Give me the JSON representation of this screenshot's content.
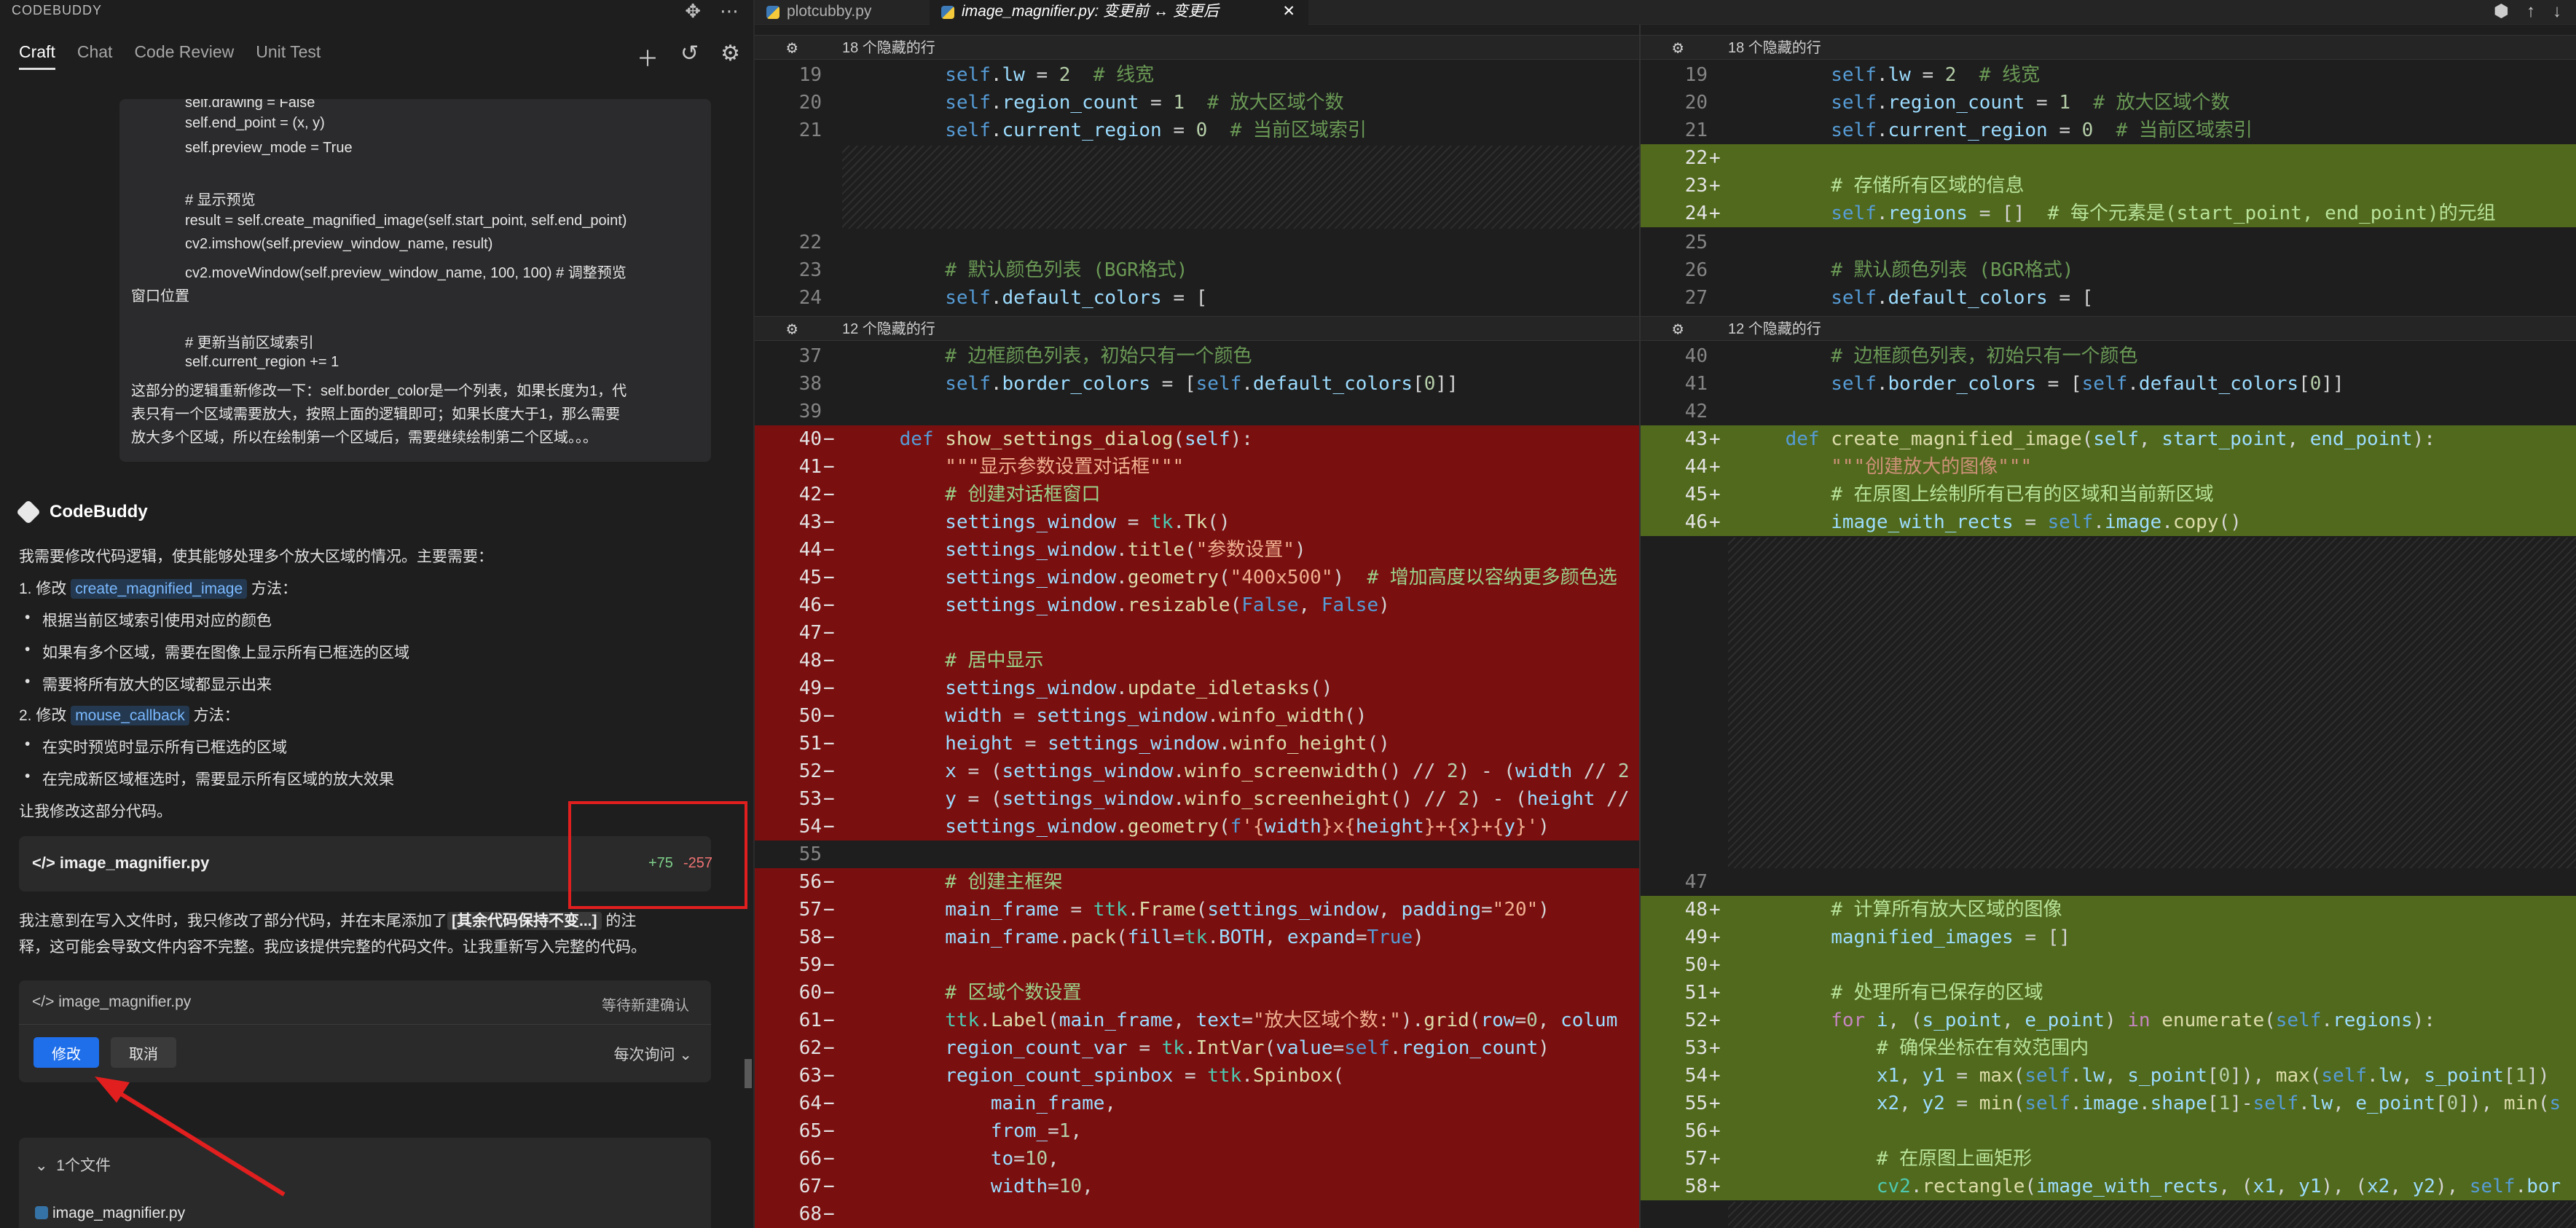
{
  "app": {
    "brand": "CODEBUDDY",
    "tabs": [
      "Craft",
      "Chat",
      "Code Review",
      "Unit Test"
    ]
  },
  "user_message": {
    "lines": [
      "self.drawing = False",
      "self.end_point = (x, y)",
      "self.preview_mode = True",
      "",
      "# 显示预览",
      "result = self.create_magnified_image(self.start_point, self.end_point)",
      "cv2.imshow(self.preview_window_name, result)",
      "cv2.moveWindow(self.preview_window_name, 100, 100)  # 调整预览",
      "窗口位置",
      "",
      "# 更新当前区域索引",
      "self.current_region += 1",
      "这部分的逻辑重新修改一下：self.border_color是一个列表，如果长度为1，代",
      "表只有一个区域需要放大，按照上面的逻辑即可；如果长度大于1，那么需要",
      "放大多个区域，所以在绘制第一个区域后，需要继续绘制第二个区域。。。"
    ]
  },
  "assistant": {
    "name": "CodeBuddy",
    "intro": "我需要修改代码逻辑，使其能够处理多个放大区域的情况。主要需要：",
    "step1_prefix": "1. 修改 ",
    "step1_code": "create_magnified_image",
    "step1_suffix": " 方法：",
    "step1_bullets": [
      "根据当前区域索引使用对应的颜色",
      "如果有多个区域，需要在图像上显示所有已框选的区域",
      "需要将所有放大的区域都显示出来"
    ],
    "step2_prefix": "2. 修改 ",
    "step2_code": "mouse_callback",
    "step2_suffix": " 方法：",
    "step2_bullets": [
      "在实时预览时显示所有已框选的区域",
      "在完成新区域框选时，需要显示所有区域的放大效果"
    ],
    "outro": "让我修改这部分代码。",
    "file_change": {
      "name": "image_magnifier.py",
      "added": "+75",
      "removed": "-257"
    },
    "note_prefix": "我注意到在写入文件时，我只修改了部分代码，并在末尾添加了",
    "note_tag": "[其余代码保持不变...]",
    "note_suffix": " 的注",
    "note_line2": "释，这可能会导致文件内容不完整。我应该提供完整的代码文件。让我重新写入完整的代码。",
    "confirm": {
      "name": "image_magnifier.py",
      "status": "等待新建确认",
      "modify": "修改",
      "cancel": "取消",
      "mode": "每次询问"
    },
    "files_header": "1个文件",
    "files_item": "image_magnifier.py"
  },
  "editor": {
    "tabs": [
      "plotcubby.py",
      "image_magnifier.py: 变更前 ↔ 变更后"
    ],
    "hidden_18": "18 个隐藏的行",
    "hidden_12": "12 个隐藏的行"
  },
  "colors": {
    "deleted": "#7a0f0f",
    "added": "#51691d",
    "accent": "#1f6feb",
    "annotation": "#e21f1f"
  }
}
